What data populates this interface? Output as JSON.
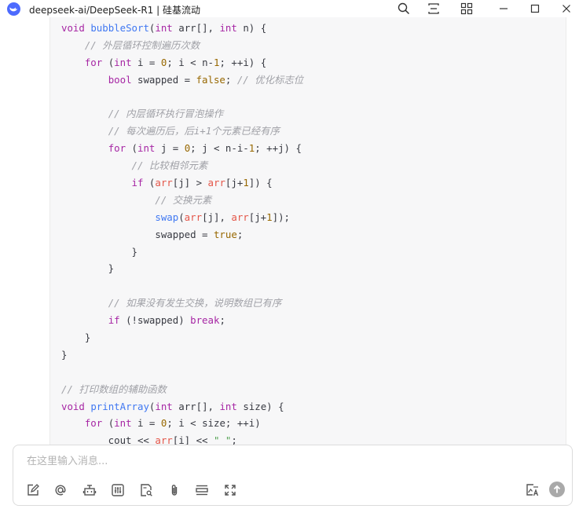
{
  "window": {
    "title": "deepseek-ai/DeepSeek-R1 | 硅基流动",
    "icons": [
      "deepseek-whale-logo",
      "search-icon",
      "layout-icon",
      "grid-icon",
      "minimize-icon",
      "maximize-icon",
      "close-icon"
    ]
  },
  "code": {
    "language": "cpp",
    "lines": [
      [
        {
          "t": "void",
          "c": "kw"
        },
        {
          "t": " "
        },
        {
          "t": "bubbleSort",
          "c": "fn"
        },
        {
          "t": "("
        },
        {
          "t": "int",
          "c": "kw"
        },
        {
          "t": " arr[], "
        },
        {
          "t": "int",
          "c": "kw"
        },
        {
          "t": " n) {"
        }
      ],
      [
        {
          "t": "    "
        },
        {
          "t": "// 外层循环控制遍历次数",
          "c": "cm"
        }
      ],
      [
        {
          "t": "    "
        },
        {
          "t": "for",
          "c": "kw"
        },
        {
          "t": " ("
        },
        {
          "t": "int",
          "c": "kw"
        },
        {
          "t": " i = "
        },
        {
          "t": "0",
          "c": "num"
        },
        {
          "t": "; i < n-"
        },
        {
          "t": "1",
          "c": "num"
        },
        {
          "t": "; ++i) {"
        }
      ],
      [
        {
          "t": "        "
        },
        {
          "t": "bool",
          "c": "kw"
        },
        {
          "t": " swapped = "
        },
        {
          "t": "false",
          "c": "num"
        },
        {
          "t": "; "
        },
        {
          "t": "// 优化标志位",
          "c": "cm"
        }
      ],
      [
        {
          "t": ""
        }
      ],
      [
        {
          "t": "        "
        },
        {
          "t": "// 内层循环执行冒泡操作",
          "c": "cm"
        }
      ],
      [
        {
          "t": "        "
        },
        {
          "t": "// 每次遍历后，后i+1个元素已经有序",
          "c": "cm"
        }
      ],
      [
        {
          "t": "        "
        },
        {
          "t": "for",
          "c": "kw"
        },
        {
          "t": " ("
        },
        {
          "t": "int",
          "c": "kw"
        },
        {
          "t": " j = "
        },
        {
          "t": "0",
          "c": "num"
        },
        {
          "t": "; j < n-i-"
        },
        {
          "t": "1",
          "c": "num"
        },
        {
          "t": "; ++j) {"
        }
      ],
      [
        {
          "t": "            "
        },
        {
          "t": "// 比较相邻元素",
          "c": "cm"
        }
      ],
      [
        {
          "t": "            "
        },
        {
          "t": "if",
          "c": "kw"
        },
        {
          "t": " ("
        },
        {
          "t": "arr",
          "c": "var"
        },
        {
          "t": "[j] > "
        },
        {
          "t": "arr",
          "c": "var"
        },
        {
          "t": "[j+"
        },
        {
          "t": "1",
          "c": "num"
        },
        {
          "t": "]) {"
        }
      ],
      [
        {
          "t": "                "
        },
        {
          "t": "// 交换元素",
          "c": "cm"
        }
      ],
      [
        {
          "t": "                "
        },
        {
          "t": "swap",
          "c": "fn"
        },
        {
          "t": "("
        },
        {
          "t": "arr",
          "c": "var"
        },
        {
          "t": "[j], "
        },
        {
          "t": "arr",
          "c": "var"
        },
        {
          "t": "[j+"
        },
        {
          "t": "1",
          "c": "num"
        },
        {
          "t": "]);"
        }
      ],
      [
        {
          "t": "                swapped = "
        },
        {
          "t": "true",
          "c": "num"
        },
        {
          "t": ";"
        }
      ],
      [
        {
          "t": "            }"
        }
      ],
      [
        {
          "t": "        }"
        }
      ],
      [
        {
          "t": ""
        }
      ],
      [
        {
          "t": "        "
        },
        {
          "t": "// 如果没有发生交换，说明数组已有序",
          "c": "cm"
        }
      ],
      [
        {
          "t": "        "
        },
        {
          "t": "if",
          "c": "kw"
        },
        {
          "t": " (!swapped) "
        },
        {
          "t": "break",
          "c": "kw"
        },
        {
          "t": ";"
        }
      ],
      [
        {
          "t": "    }"
        }
      ],
      [
        {
          "t": "}"
        }
      ],
      [
        {
          "t": ""
        }
      ],
      [
        {
          "t": "// 打印数组的辅助函数",
          "c": "cm"
        }
      ],
      [
        {
          "t": "void",
          "c": "kw"
        },
        {
          "t": " "
        },
        {
          "t": "printArray",
          "c": "fn"
        },
        {
          "t": "("
        },
        {
          "t": "int",
          "c": "kw"
        },
        {
          "t": " arr[], "
        },
        {
          "t": "int",
          "c": "kw"
        },
        {
          "t": " size) {"
        }
      ],
      [
        {
          "t": "    "
        },
        {
          "t": "for",
          "c": "kw"
        },
        {
          "t": " ("
        },
        {
          "t": "int",
          "c": "kw"
        },
        {
          "t": " i = "
        },
        {
          "t": "0",
          "c": "num"
        },
        {
          "t": "; i < size; ++i)"
        }
      ],
      [
        {
          "t": "        cout << "
        },
        {
          "t": "arr",
          "c": "var"
        },
        {
          "t": "[i] << "
        },
        {
          "t": "\" \"",
          "c": "str"
        },
        {
          "t": ";"
        }
      ]
    ]
  },
  "composer": {
    "placeholder": "在这里输入消息...",
    "tools": [
      "edit-icon",
      "at-mention-icon",
      "bot-icon",
      "sliders-icon",
      "file-search-icon",
      "paperclip-icon",
      "divider-lines-icon",
      "expand-icon"
    ],
    "right_tools": [
      "translate-image-icon",
      "send-icon"
    ]
  }
}
